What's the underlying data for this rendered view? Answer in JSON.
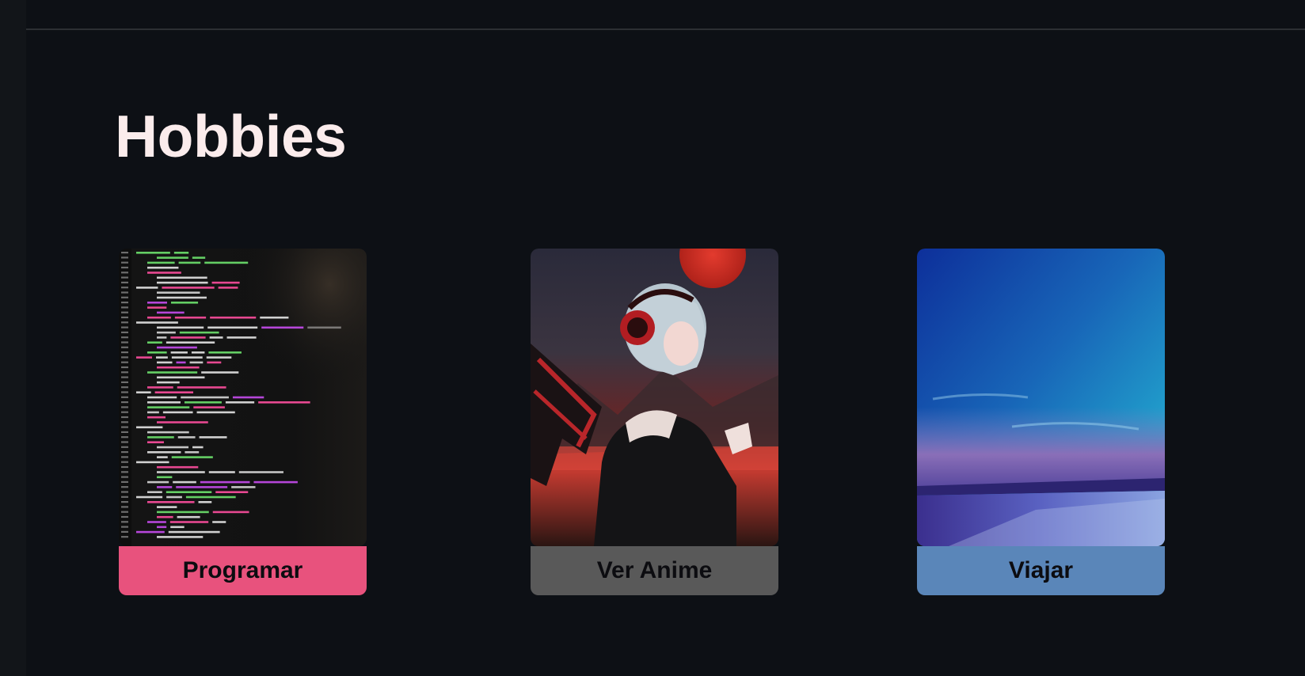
{
  "section": {
    "title": "Hobbies"
  },
  "cards": [
    {
      "label": "Programar",
      "image": "code-editor-screenshot",
      "color": "#e8527d"
    },
    {
      "label": "Ver Anime",
      "image": "anime-girl-headphones-wings-red-moon",
      "color": "#595959"
    },
    {
      "label": "Viajar",
      "image": "blue-sky-sunset-coast",
      "color": "#5a86b9"
    }
  ]
}
